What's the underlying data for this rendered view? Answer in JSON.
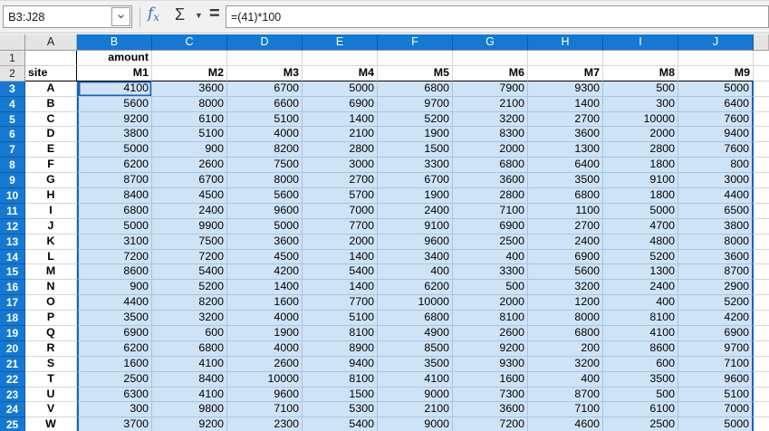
{
  "toolbar": {
    "name_box_value": "B3:J28",
    "name_box_dropdown_icon": "⌄",
    "fx_icon_f": "f",
    "fx_icon_x": "x",
    "sum_icon": "Σ",
    "sum_dropdown_icon": "▼",
    "equals_icon": "=",
    "formula_input_value": "=(41)*100"
  },
  "grid": {
    "column_headers": [
      "A",
      "B",
      "C",
      "D",
      "E",
      "F",
      "G",
      "H",
      "I",
      "J"
    ],
    "row1_number": "1",
    "row1_label": "amount",
    "row2_number": "2",
    "row2_label": "site",
    "month_headers": [
      "M1",
      "M2",
      "M3",
      "M4",
      "M5",
      "M6",
      "M7",
      "M8",
      "M9"
    ],
    "selection": {
      "range": "B3:J28",
      "active_cell": "B3",
      "selected_columns": [
        "B",
        "C",
        "D",
        "E",
        "F",
        "G",
        "H",
        "I",
        "J"
      ]
    },
    "rows": [
      {
        "number": "3",
        "site": "A",
        "values": [
          4100,
          3600,
          6700,
          5000,
          6800,
          7900,
          9300,
          500,
          5000
        ]
      },
      {
        "number": "4",
        "site": "B",
        "values": [
          5600,
          8000,
          6600,
          6900,
          9700,
          2100,
          1400,
          300,
          6400
        ]
      },
      {
        "number": "5",
        "site": "C",
        "values": [
          9200,
          6100,
          5100,
          1400,
          5200,
          3200,
          2700,
          10000,
          7600
        ]
      },
      {
        "number": "6",
        "site": "D",
        "values": [
          3800,
          5100,
          4000,
          2100,
          1900,
          8300,
          3600,
          2000,
          9400
        ]
      },
      {
        "number": "7",
        "site": "E",
        "values": [
          5000,
          900,
          8200,
          2800,
          1500,
          2000,
          1300,
          2800,
          7600
        ]
      },
      {
        "number": "8",
        "site": "F",
        "values": [
          6200,
          2600,
          7500,
          3000,
          3300,
          6800,
          6400,
          1800,
          800
        ]
      },
      {
        "number": "9",
        "site": "G",
        "values": [
          8700,
          6700,
          8000,
          2700,
          6700,
          3600,
          3500,
          9100,
          3000
        ]
      },
      {
        "number": "10",
        "site": "H",
        "values": [
          8400,
          4500,
          5600,
          5700,
          1900,
          2800,
          6800,
          1800,
          4400
        ]
      },
      {
        "number": "11",
        "site": "I",
        "values": [
          6800,
          2400,
          9600,
          7000,
          2400,
          7100,
          1100,
          5000,
          6500
        ]
      },
      {
        "number": "12",
        "site": "J",
        "values": [
          5000,
          9900,
          5000,
          7700,
          9100,
          6900,
          2700,
          4700,
          3800
        ]
      },
      {
        "number": "13",
        "site": "K",
        "values": [
          3100,
          7500,
          3600,
          2000,
          9600,
          2500,
          2400,
          4800,
          8000
        ]
      },
      {
        "number": "14",
        "site": "L",
        "values": [
          7200,
          7200,
          4500,
          1400,
          3400,
          400,
          6900,
          5200,
          3600
        ]
      },
      {
        "number": "15",
        "site": "M",
        "values": [
          8600,
          5400,
          4200,
          5400,
          400,
          3300,
          5600,
          1300,
          8700
        ]
      },
      {
        "number": "16",
        "site": "N",
        "values": [
          900,
          5200,
          1400,
          1400,
          6200,
          500,
          3200,
          2400,
          2900
        ]
      },
      {
        "number": "17",
        "site": "O",
        "values": [
          4400,
          8200,
          1600,
          7700,
          10000,
          2000,
          1200,
          400,
          5200
        ]
      },
      {
        "number": "18",
        "site": "P",
        "values": [
          3500,
          3200,
          4000,
          5100,
          6800,
          8100,
          8000,
          8100,
          4200
        ]
      },
      {
        "number": "19",
        "site": "Q",
        "values": [
          6900,
          600,
          1900,
          8100,
          4900,
          2600,
          6800,
          4100,
          6900
        ]
      },
      {
        "number": "20",
        "site": "R",
        "values": [
          6200,
          6800,
          4000,
          8900,
          8500,
          9200,
          200,
          8600,
          9700
        ]
      },
      {
        "number": "21",
        "site": "S",
        "values": [
          1600,
          4100,
          2600,
          9400,
          3500,
          9300,
          3200,
          600,
          7100
        ]
      },
      {
        "number": "22",
        "site": "T",
        "values": [
          2500,
          8400,
          10000,
          8100,
          4100,
          1600,
          400,
          3500,
          9600
        ]
      },
      {
        "number": "23",
        "site": "U",
        "values": [
          6300,
          4100,
          9600,
          1500,
          9000,
          7300,
          8700,
          500,
          5100
        ]
      },
      {
        "number": "24",
        "site": "V",
        "values": [
          300,
          9800,
          7100,
          5300,
          2100,
          3600,
          7100,
          6100,
          7000
        ]
      },
      {
        "number": "25",
        "site": "W",
        "values": [
          3700,
          9200,
          2300,
          5400,
          9000,
          7200,
          4600,
          2500,
          5000
        ]
      }
    ]
  },
  "colors": {
    "header_blue": "#1579d2",
    "header_gray": "#e4e4e4",
    "selection_bg": "#cfe3f6",
    "selection_gridline": "#a9c4e0",
    "selection_border": "#1565c0",
    "gridline": "#d6d6d6",
    "toolbar_bg": "#f1f1f1",
    "fx_blue": "#3a72b8"
  }
}
